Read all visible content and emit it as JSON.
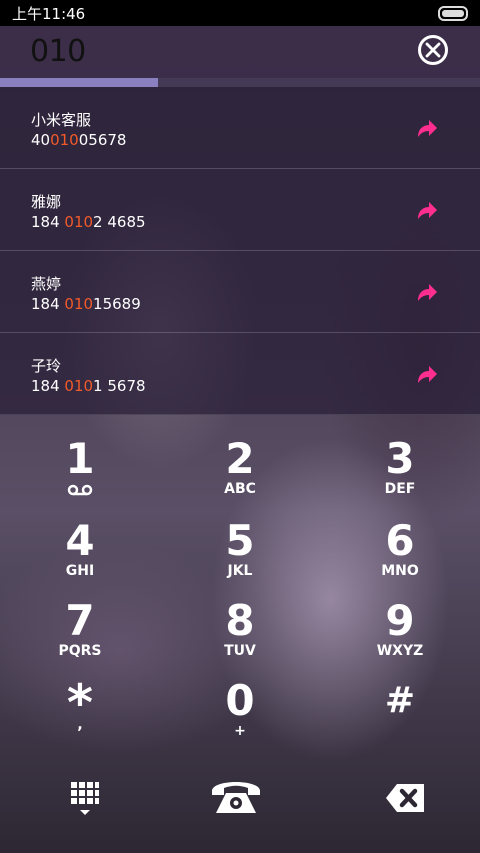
{
  "status": {
    "time": "上午11:46"
  },
  "search": {
    "query": "010"
  },
  "progress": {
    "fraction": 0.33
  },
  "results": [
    {
      "name": "小米客服",
      "pre": "40",
      "hl": "010",
      "post": "05678"
    },
    {
      "name": "雅娜",
      "pre": "184 ",
      "hl": "010",
      "post": "2 4685"
    },
    {
      "name": "燕婷",
      "pre": "184 ",
      "hl": "010",
      "post": "15689"
    },
    {
      "name": "子玲",
      "pre": "184 ",
      "hl": "010",
      "post": "1 5678"
    }
  ],
  "keys": [
    {
      "digit": "1",
      "letters": ""
    },
    {
      "digit": "2",
      "letters": "ABC"
    },
    {
      "digit": "3",
      "letters": "DEF"
    },
    {
      "digit": "4",
      "letters": "GHI"
    },
    {
      "digit": "5",
      "letters": "JKL"
    },
    {
      "digit": "6",
      "letters": "MNO"
    },
    {
      "digit": "7",
      "letters": "PQRS"
    },
    {
      "digit": "8",
      "letters": "TUV"
    },
    {
      "digit": "9",
      "letters": "WXYZ"
    },
    {
      "digit": "*",
      "letters": ","
    },
    {
      "digit": "0",
      "letters": "+"
    },
    {
      "digit": "#",
      "letters": ""
    }
  ],
  "icons": {
    "clear": "close-circle-icon",
    "share": "share-arrow-icon",
    "voicemail": "voicemail-icon",
    "keypad": "dialpad-toggle-icon",
    "call": "phone-icon",
    "backspace": "backspace-icon"
  },
  "colors": {
    "highlight": "#f35a2a",
    "share": "#ff2e8f",
    "progress": "#8a7fbf"
  }
}
